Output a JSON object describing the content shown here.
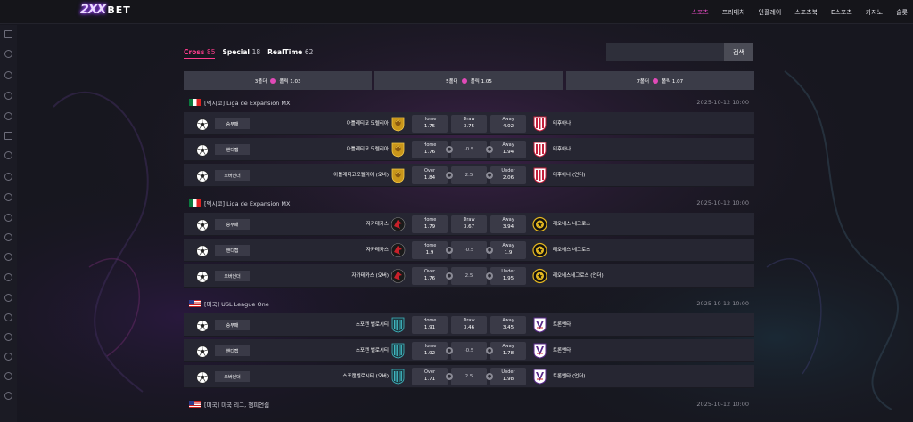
{
  "logo": {
    "part1": "2XX",
    "part2": "BET"
  },
  "nav": [
    "스포츠",
    "프리매치",
    "인플레이",
    "스포츠북",
    "E스포츠",
    "카지노",
    "슬롯"
  ],
  "tabs": [
    {
      "label": "Cross",
      "count": "85"
    },
    {
      "label": "Special",
      "count": "18"
    },
    {
      "label": "RealTime",
      "count": "62"
    }
  ],
  "search": {
    "placeholder": "",
    "button": "검색"
  },
  "folders": [
    {
      "label": "3폴더",
      "bonus": "폴릭 1.03"
    },
    {
      "label": "5폴더",
      "bonus": "폴릭 1.05"
    },
    {
      "label": "7폴더",
      "bonus": "폴릭 1.07"
    }
  ],
  "colors": {
    "accent": "#ff3c8c",
    "nav_active": "#e44bc2",
    "row_bg": "#262632",
    "odds_bg": "#3a3a47"
  },
  "leagues": [
    {
      "flag": "mx",
      "name": "[멕시코] Liga de Expansion MX",
      "time": "2025-10-12 10:00",
      "home_logo": "cougar-crest-icon",
      "away_logo": "striped-crest-icon",
      "rows": [
        {
          "type": "승무패",
          "home": "아틀레티코 모렐리아",
          "away": "티후아나",
          "o1l": "Home",
          "o1v": "1.75",
          "o2l": "Draw",
          "o2v": "3.75",
          "o3l": "Away",
          "o3v": "4.02",
          "mid": false
        },
        {
          "type": "핸디캡",
          "home": "아틀레티코 모렐리아",
          "away": "티후아나",
          "o1l": "Home",
          "o1v": "1.76",
          "o2l": "",
          "o2v": "-0.5",
          "o3l": "Away",
          "o3v": "1.94",
          "mid": true
        },
        {
          "type": "오버언더",
          "home": "아틀레티코모렐리아 (오버)",
          "away": "티후아나 (언더)",
          "o1l": "Over",
          "o1v": "1.84",
          "o2l": "",
          "o2v": "2.5",
          "o3l": "Under",
          "o3v": "2.06",
          "mid": true
        }
      ]
    },
    {
      "flag": "mx",
      "name": "[멕시코] Liga de Expansion MX",
      "time": "2025-10-12 10:00",
      "home_logo": "bird-crest-icon",
      "away_logo": "gold-star-crest-icon",
      "rows": [
        {
          "type": "승무패",
          "home": "자카테카스",
          "away": "레오네스 네그로스",
          "o1l": "Home",
          "o1v": "1.79",
          "o2l": "Draw",
          "o2v": "3.67",
          "o3l": "Away",
          "o3v": "3.94",
          "mid": false
        },
        {
          "type": "핸디캡",
          "home": "자카테카스",
          "away": "레오네스 네그로스",
          "o1l": "Home",
          "o1v": "1.9",
          "o2l": "",
          "o2v": "-0.5",
          "o3l": "Away",
          "o3v": "1.9",
          "mid": true
        },
        {
          "type": "오버언더",
          "home": "자카테카스 (오버)",
          "away": "레오네스네그로스 (언더)",
          "o1l": "Over",
          "o1v": "1.76",
          "o2l": "",
          "o2v": "2.5",
          "o3l": "Under",
          "o3v": "1.95",
          "mid": true
        }
      ]
    },
    {
      "flag": "us",
      "name": "[미국] USL League One",
      "time": "2025-10-12 10:00",
      "home_logo": "teal-stripe-crest-icon",
      "away_logo": "purple-v-crest-icon",
      "rows": [
        {
          "type": "승무패",
          "home": "스포캔 벨로시티",
          "away": "토론맨타",
          "o1l": "Home",
          "o1v": "1.91",
          "o2l": "Draw",
          "o2v": "3.46",
          "o3l": "Away",
          "o3v": "3.45",
          "mid": false
        },
        {
          "type": "핸디캡",
          "home": "스포캔 벨로시티",
          "away": "토론맨타",
          "o1l": "Home",
          "o1v": "1.92",
          "o2l": "",
          "o2v": "-0.5",
          "o3l": "Away",
          "o3v": "1.78",
          "mid": true
        },
        {
          "type": "오버언더",
          "home": "스포캔벨로시티 (오버)",
          "away": "토론맨타 (언더)",
          "o1l": "Over",
          "o1v": "1.71",
          "o2l": "",
          "o2v": "2.5",
          "o3l": "Under",
          "o3v": "1.98",
          "mid": true
        }
      ]
    },
    {
      "flag": "us",
      "name": "[미국] 미국 리그, 챔피언쉽",
      "time": "2025-10-12 10:00",
      "rows": []
    }
  ]
}
